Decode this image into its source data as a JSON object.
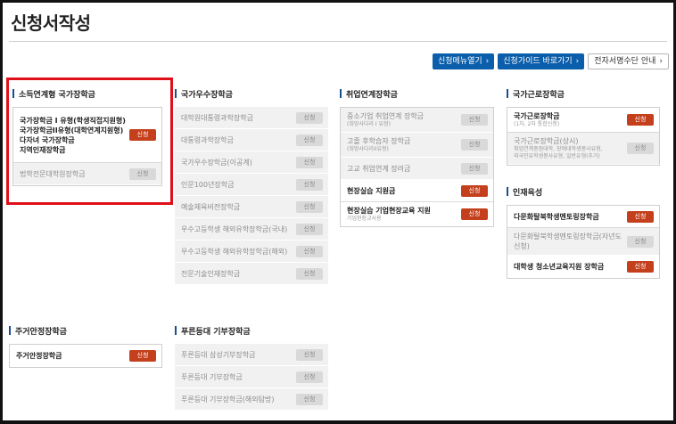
{
  "page": {
    "title": "신청서작성"
  },
  "top_buttons": [
    {
      "label": "신청메뉴열기",
      "style": "primary"
    },
    {
      "label": "신청가이드 바로가기",
      "style": "primary"
    },
    {
      "label": "전자서명수단 안내",
      "style": "light"
    }
  ],
  "apply_label": "신청",
  "sections": {
    "income": {
      "title": "소득연계형 국가장학금",
      "rows": [
        {
          "label": "국가장학금 I 유형(학생직접지원형)\n국가장학금II유형(대학연계지원형)\n다자녀 국가장학금\n지역인재장학금",
          "active": true
        },
        {
          "label": "법학전문대학원장학금",
          "active": false
        }
      ]
    },
    "excellence": {
      "title": "국가우수장학금",
      "rows": [
        {
          "label": "대학원대통령과학장학금",
          "active": false
        },
        {
          "label": "대통령과학장학금",
          "active": false
        },
        {
          "label": "국가우수장학금(이공계)",
          "active": false
        },
        {
          "label": "인문100년장학금",
          "active": false
        },
        {
          "label": "예술체육비전장학금",
          "active": false
        },
        {
          "label": "우수고등학생 해외유학장학금(국내)",
          "active": false
        },
        {
          "label": "우수고등학생 해외유학장학금(해외)",
          "active": false
        },
        {
          "label": "전문기술인재장학금",
          "active": false
        }
      ]
    },
    "employment": {
      "title": "취업연계장학금",
      "rows": [
        {
          "label": "중소기업 취업연계 장학금",
          "sub": "(희망사다리 I 유형)",
          "active": false
        },
        {
          "label": "고졸 후학습자 장학금",
          "sub": "(희망사다리II유형)",
          "active": false
        },
        {
          "label": "고교 취업연계 장려금",
          "active": false
        },
        {
          "label": "현장실습 지원금",
          "active": true
        },
        {
          "label": "현장실습 기업현장교육 지원",
          "sub": "기업현장교사용",
          "active": true
        }
      ]
    },
    "work": {
      "title": "국가근로장학금",
      "rows": [
        {
          "label": "국가근로장학금",
          "sub": "(1차, 2차 통합신청)",
          "active": true
        },
        {
          "label": "국가근로장학금(상시)",
          "sub": "취업연계중점대학, 장애대학생봉사유형,\n외국인유학생봉사유형, 일반유형(추가)",
          "active": false
        }
      ]
    },
    "talent": {
      "title": "인재육성",
      "rows": [
        {
          "label": "다문화탈북학생멘토링장학금",
          "active": true
        },
        {
          "label": "다문화탈북학생멘토링장학금(자년도 신청)",
          "active": false
        },
        {
          "label": "대학생 청소년교육지원 장학금",
          "active": true
        }
      ]
    },
    "housing": {
      "title": "주거안정장학금",
      "rows": [
        {
          "label": "주거안정장학금",
          "active": true
        }
      ]
    },
    "dream": {
      "title": "푸른등대 기부장학금",
      "rows": [
        {
          "label": "푸른등대 삼성기부장학금",
          "active": false
        },
        {
          "label": "푸른등대 기부장학금",
          "active": false
        },
        {
          "label": "푸른등대 기부장학금(해외탐방)",
          "active": false
        }
      ]
    }
  }
}
